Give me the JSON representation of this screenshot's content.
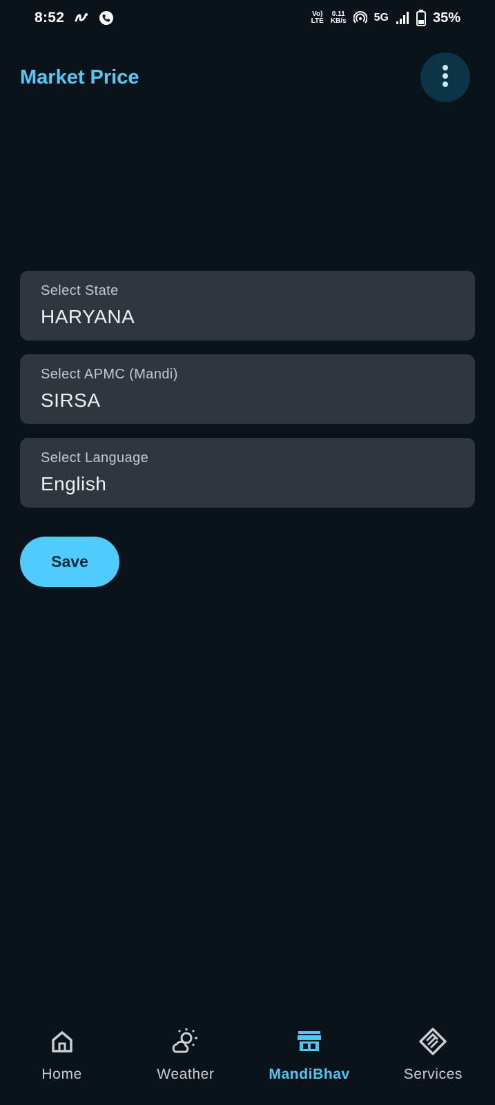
{
  "status_bar": {
    "time": "8:52",
    "volte_top": "Vo)",
    "volte_bottom": "LTE",
    "speed_value": "0.11",
    "speed_unit": "KB/s",
    "network": "5G",
    "battery": "35%"
  },
  "app_bar": {
    "title": "Market Price",
    "menu_icon": "more-vert-icon"
  },
  "form": {
    "state": {
      "label": "Select State",
      "value": "HARYANA"
    },
    "apmc": {
      "label": "Select APMC (Mandi)",
      "value": "SIRSA"
    },
    "language": {
      "label": "Select Language",
      "value": "English"
    }
  },
  "save_label": "Save",
  "bottom_nav": {
    "items": [
      {
        "label": "Home",
        "icon": "home-icon",
        "active": false
      },
      {
        "label": "Weather",
        "icon": "weather-icon",
        "active": false
      },
      {
        "label": "MandiBhav",
        "icon": "store-icon",
        "active": true
      },
      {
        "label": "Services",
        "icon": "handshake-icon",
        "active": false
      }
    ]
  },
  "colors": {
    "background": "#0b131a",
    "accent": "#4fcbfd",
    "field_bg": "#2f363e",
    "title": "#56c8f5"
  }
}
